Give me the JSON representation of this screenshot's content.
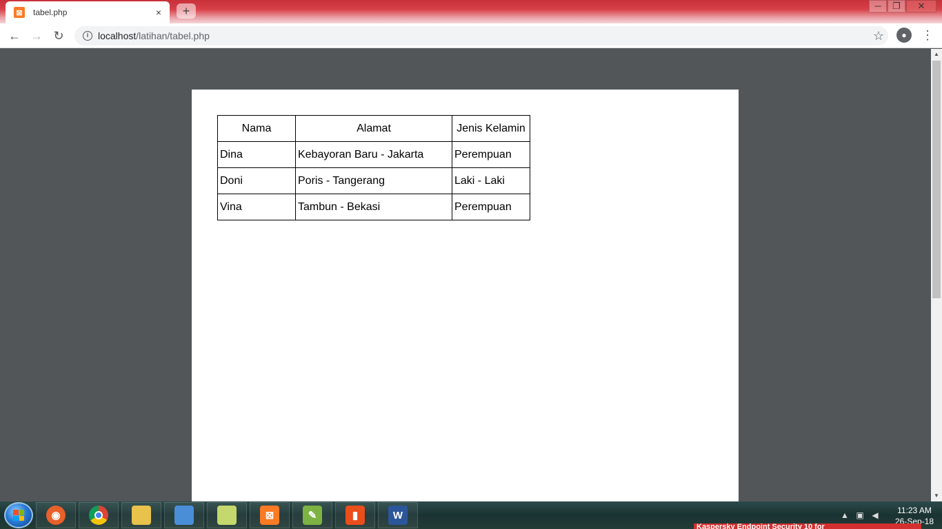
{
  "browser": {
    "tab_title": "tabel.php",
    "tab_favicon": "xampp-icon",
    "new_tab_label": "+",
    "close_tab_glyph": "×",
    "url_host": "localhost",
    "url_path": "/latihan/tabel.php"
  },
  "window_controls": {
    "minimize": "─",
    "restore": "❐",
    "close": "✕"
  },
  "table": {
    "headers": [
      "Nama",
      "Alamat",
      "Jenis Kelamin"
    ],
    "rows": [
      [
        "Dina",
        "Kebayoran Baru - Jakarta",
        "Perempuan"
      ],
      [
        "Doni",
        "Poris - Tangerang",
        "Laki - Laki"
      ],
      [
        "Vina",
        "Tambun - Bekasi",
        "Perempuan"
      ]
    ]
  },
  "taskbar": {
    "apps": [
      {
        "name": "firefox",
        "icon": "firefox-icon",
        "color": "#e8602a"
      },
      {
        "name": "chrome",
        "icon": "chrome-icon",
        "color": "#2a9b3f"
      },
      {
        "name": "file-explorer",
        "icon": "folder-icon",
        "color": "#e8c24a"
      },
      {
        "name": "control-panel",
        "icon": "control-panel-icon",
        "color": "#4a8ed8"
      },
      {
        "name": "folder-2",
        "icon": "folder-icon",
        "color": "#9ccc65"
      },
      {
        "name": "xampp",
        "icon": "xampp-icon",
        "color": "#fb7a24"
      },
      {
        "name": "notepad-plus-plus",
        "icon": "notepad-icon",
        "color": "#7cb342"
      },
      {
        "name": "office",
        "icon": "office-icon",
        "color": "#ea4e1b"
      },
      {
        "name": "word",
        "icon": "word-icon",
        "color": "#2b579a"
      }
    ],
    "time": "11:23 AM",
    "date": "26-Sep-18",
    "notification": "Kaspersky Endpoint Security 10 for"
  }
}
